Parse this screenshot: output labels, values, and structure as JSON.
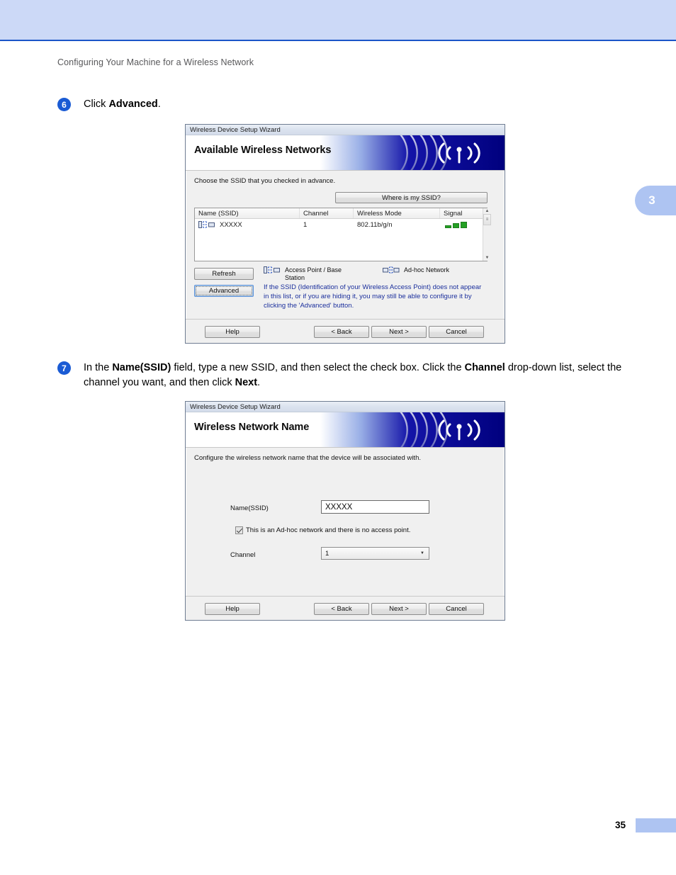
{
  "page": {
    "running_head": "Configuring Your Machine for a Wireless Network",
    "chapter_tab": "3",
    "page_number": "35"
  },
  "steps": [
    {
      "number": "6",
      "parts": [
        {
          "text": "Click ",
          "bold": false
        },
        {
          "text": "Advanced",
          "bold": true
        },
        {
          "text": ".",
          "bold": false
        }
      ]
    },
    {
      "number": "7",
      "parts": [
        {
          "text": "In the ",
          "bold": false
        },
        {
          "text": "Name(SSID)",
          "bold": true
        },
        {
          "text": " field, type a new SSID, and then select the check box. Click the ",
          "bold": false
        },
        {
          "text": "Channel",
          "bold": true
        },
        {
          "text": " drop-down list, select the channel you want, and then click ",
          "bold": false
        },
        {
          "text": "Next",
          "bold": true
        },
        {
          "text": ".",
          "bold": false
        }
      ]
    }
  ],
  "dialog_available": {
    "titlebar": "Wireless Device Setup Wizard",
    "banner_title": "Available Wireless Networks",
    "subtitle": "Choose the SSID that you checked in advance.",
    "where_button": "Where is my SSID?",
    "columns": [
      "Name (SSID)",
      "Channel",
      "Wireless Mode",
      "Signal"
    ],
    "rows": [
      {
        "name": "XXXXX",
        "channel": "1",
        "mode": "802.11b/g/n",
        "signal_bars": 3
      }
    ],
    "refresh_button": "Refresh",
    "advanced_button": "Advanced",
    "legend_access_point": "Access Point / Base Station",
    "legend_adhoc": "Ad-hoc Network",
    "hint": "If the SSID (Identification of your Wireless Access Point) does not appear in this list, or if you are hiding it, you may still be able to configure it by clicking the 'Advanced' button.",
    "footer": {
      "help": "Help",
      "back": "< Back",
      "next": "Next >",
      "cancel": "Cancel"
    }
  },
  "dialog_network_name": {
    "titlebar": "Wireless Device Setup Wizard",
    "banner_title": "Wireless Network Name",
    "subtitle": "Configure the wireless network name that the device will be associated with.",
    "ssid_label": "Name(SSID)",
    "ssid_value": "XXXXX",
    "ssid_placeholder": "",
    "adhoc_checkbox_label": "This is an Ad-hoc network and there is no access point.",
    "adhoc_checked": true,
    "channel_label": "Channel",
    "channel_value": "1",
    "footer": {
      "help": "Help",
      "back": "< Back",
      "next": "Next >",
      "cancel": "Cancel"
    }
  },
  "colors": {
    "header_band": "#ccd9f7",
    "header_rule": "#1a55c8",
    "step_badge": "#1a5bd4",
    "hint_text": "#1b2f9c",
    "signal_green": "#24a024",
    "banner_blue": "#0000b4",
    "chapter_tab": "#aec4f2"
  }
}
